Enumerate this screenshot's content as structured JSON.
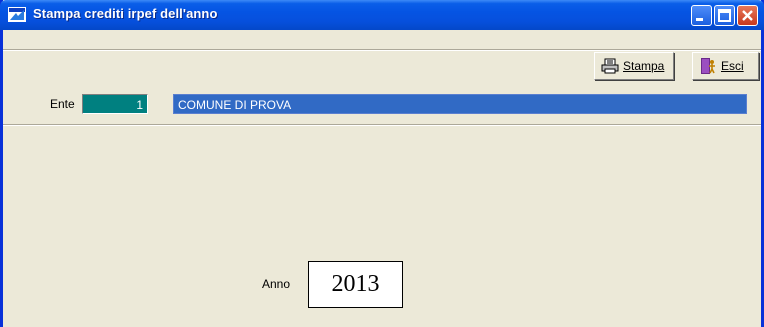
{
  "window": {
    "title": "Stampa crediti irpef dell'anno"
  },
  "titlebar_buttons": {
    "minimize": "minimize",
    "maximize": "maximize",
    "close": "close"
  },
  "toolbar": {
    "print_label": "Stampa",
    "exit_label": "Esci"
  },
  "ente": {
    "label": "Ente",
    "code": "1",
    "name": "COMUNE DI PROVA"
  },
  "anno": {
    "label": "Anno",
    "value": "2013"
  },
  "colors": {
    "titlebar": "#0554e3",
    "window_bg": "#ece9d8",
    "ente_code_bg": "#008080",
    "ente_name_bg": "#316ac5",
    "close_button": "#c7381d"
  },
  "icons": {
    "app": "app-window-icon",
    "print": "printer-icon",
    "exit": "exit-door-icon"
  }
}
